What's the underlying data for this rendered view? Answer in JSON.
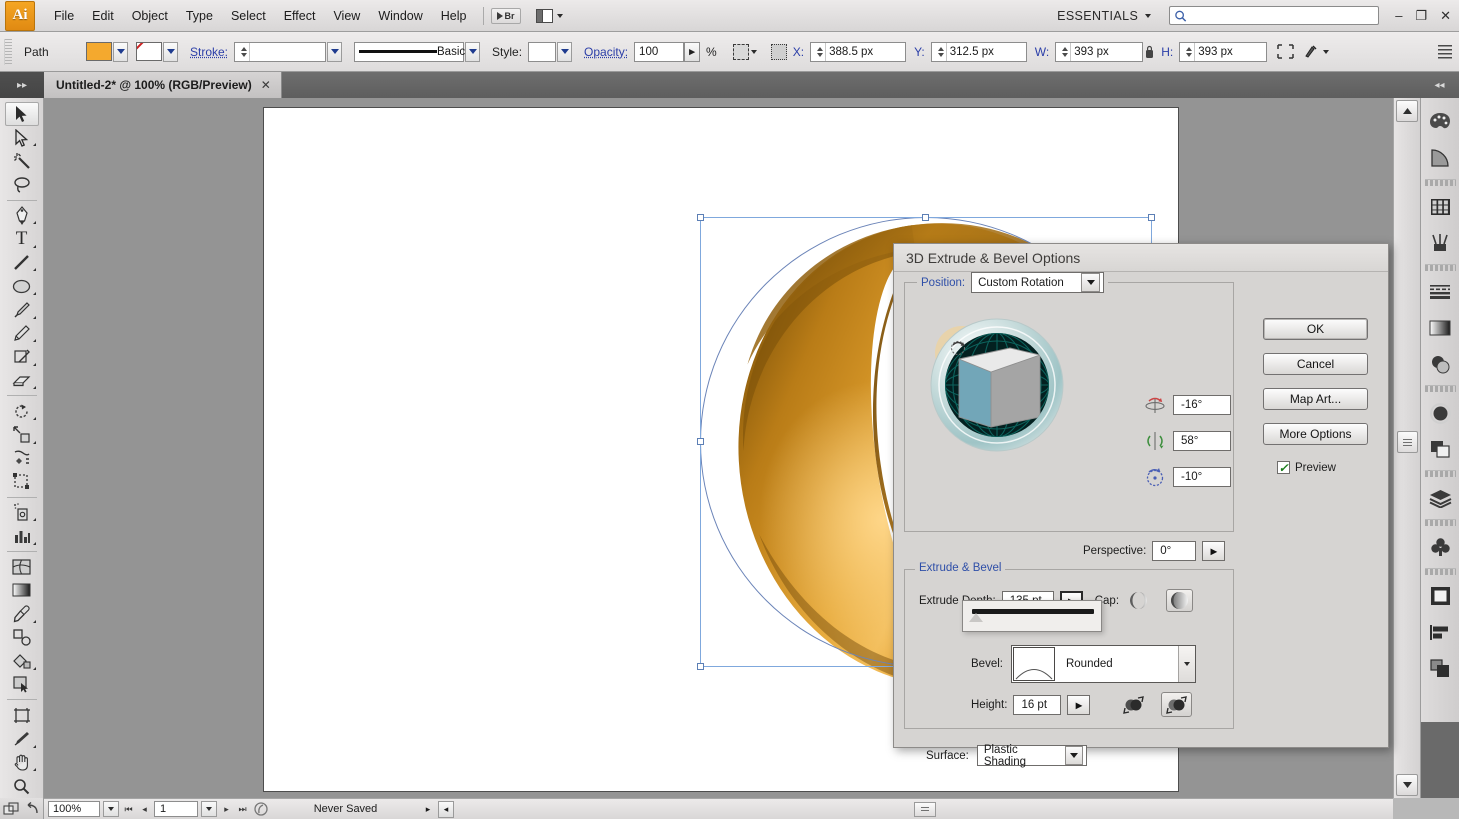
{
  "app": {
    "name": "Ai",
    "menus": [
      "File",
      "Edit",
      "Object",
      "Type",
      "Select",
      "Effect",
      "View",
      "Window",
      "Help"
    ],
    "bridge_label": "Br",
    "workspace": "ESSENTIALS",
    "search_placeholder": "",
    "search_value": "",
    "window_controls": {
      "minimize": "–",
      "maximize": "❐",
      "close": "✕"
    }
  },
  "control_bar": {
    "object_label": "Path",
    "fill_color": "#f4a92e",
    "stroke_color": "none",
    "stroke_label": "Stroke:",
    "stroke_weight": "",
    "brush_label": "Basic",
    "style_label": "Style:",
    "style_value": "",
    "opacity_label": "Opacity:",
    "opacity_value": "100",
    "percent_sign": "%",
    "x_label": "X:",
    "x_value": "388.5 px",
    "y_label": "Y:",
    "y_value": "312.5 px",
    "w_label": "W:",
    "w_value": "393 px",
    "h_label": "H:",
    "h_value": "393 px"
  },
  "document": {
    "tab_title": "Untitled-2* @ 100% (RGB/Preview)",
    "close_glyph": "✕"
  },
  "toolbox": {
    "tools": [
      {
        "name": "selection-tool",
        "glyph": "selection",
        "active": true,
        "corner": false
      },
      {
        "name": "direct-selection-tool",
        "glyph": "direct-selection",
        "active": false,
        "corner": true
      },
      {
        "name": "magic-wand-tool",
        "glyph": "magic-wand",
        "active": false,
        "corner": false
      },
      {
        "name": "lasso-tool",
        "glyph": "lasso",
        "active": false,
        "corner": false
      },
      {
        "name": "pen-tool",
        "glyph": "pen",
        "active": false,
        "corner": true
      },
      {
        "name": "type-tool",
        "glyph": "type",
        "active": false,
        "corner": true
      },
      {
        "name": "line-segment-tool",
        "glyph": "line",
        "active": false,
        "corner": true
      },
      {
        "name": "ellipse-tool",
        "glyph": "ellipse",
        "active": false,
        "corner": true
      },
      {
        "name": "paintbrush-tool",
        "glyph": "paintbrush",
        "active": false,
        "corner": true
      },
      {
        "name": "pencil-tool",
        "glyph": "pencil",
        "active": false,
        "corner": true
      },
      {
        "name": "blob-brush-tool",
        "glyph": "blob-brush",
        "active": false,
        "corner": true
      },
      {
        "name": "eraser-tool",
        "glyph": "eraser",
        "active": false,
        "corner": true
      },
      {
        "name": "rotate-tool",
        "glyph": "rotate",
        "active": false,
        "corner": true
      },
      {
        "name": "scale-tool",
        "glyph": "scale",
        "active": false,
        "corner": true
      },
      {
        "name": "warp-tool",
        "glyph": "warp",
        "active": false,
        "corner": true
      },
      {
        "name": "free-transform-tool",
        "glyph": "free-transform",
        "active": false,
        "corner": false
      },
      {
        "name": "symbol-sprayer-tool",
        "glyph": "symbol-sprayer",
        "active": false,
        "corner": true
      },
      {
        "name": "column-graph-tool",
        "glyph": "graph",
        "active": false,
        "corner": true
      },
      {
        "name": "mesh-tool",
        "glyph": "mesh",
        "active": false,
        "corner": false
      },
      {
        "name": "gradient-tool",
        "glyph": "gradient",
        "active": false,
        "corner": false
      },
      {
        "name": "eyedropper-tool",
        "glyph": "eyedropper",
        "active": false,
        "corner": true
      },
      {
        "name": "blend-tool",
        "glyph": "blend",
        "active": false,
        "corner": false
      },
      {
        "name": "live-paint-bucket-tool",
        "glyph": "live-paint",
        "active": false,
        "corner": true
      },
      {
        "name": "live-paint-selection-tool",
        "glyph": "live-paint-select",
        "active": false,
        "corner": false
      },
      {
        "name": "artboard-tool",
        "glyph": "artboard",
        "active": false,
        "corner": false
      },
      {
        "name": "slice-tool",
        "glyph": "slice",
        "active": false,
        "corner": true
      },
      {
        "name": "hand-tool",
        "glyph": "hand",
        "active": false,
        "corner": true
      },
      {
        "name": "zoom-tool",
        "glyph": "zoom",
        "active": false,
        "corner": false
      }
    ]
  },
  "right_dock": {
    "panels": [
      {
        "name": "color-panel",
        "glyph": "palette"
      },
      {
        "name": "color-guide-panel",
        "glyph": "color-guide"
      },
      {
        "name": "swatches-panel",
        "glyph": "swatches"
      },
      {
        "name": "brushes-panel",
        "glyph": "brushes"
      },
      {
        "name": "stroke-panel",
        "glyph": "stroke-lines"
      },
      {
        "name": "gradient-panel",
        "glyph": "gradient-box"
      },
      {
        "name": "transparency-panel",
        "glyph": "transparency"
      },
      {
        "name": "appearance-panel",
        "glyph": "appearance"
      },
      {
        "name": "graphic-styles-panel",
        "glyph": "graphic-styles"
      },
      {
        "name": "layers-panel",
        "glyph": "layers"
      },
      {
        "name": "symbols-panel",
        "glyph": "symbols"
      },
      {
        "name": "artboards-panel",
        "glyph": "artboards"
      },
      {
        "name": "align-panel",
        "glyph": "align"
      },
      {
        "name": "pathfinder-panel",
        "glyph": "pathfinder"
      }
    ]
  },
  "status_bar": {
    "zoom_level": "100%",
    "page_number": "1",
    "status_text": "Never Saved"
  },
  "dialog": {
    "title": "3D Extrude & Bevel Options",
    "position_label": "Position:",
    "position_value": "Custom Rotation",
    "rotation_x": "-16°",
    "rotation_y": "58°",
    "rotation_z": "-10°",
    "perspective_label": "Perspective:",
    "perspective_value": "0°",
    "buttons": {
      "ok": "OK",
      "cancel": "Cancel",
      "map_art": "Map Art...",
      "more_options": "More Options",
      "preview": "Preview",
      "preview_checked": true
    },
    "extrude_group_title": "Extrude & Bevel",
    "extrude_depth_label": "Extrude Depth:",
    "extrude_depth_value": "135 pt",
    "cap_label": "Cap:",
    "bevel_label": "Bevel:",
    "bevel_value": "Rounded",
    "height_label": "Height:",
    "height_value": "16 pt",
    "surface_label": "Surface:",
    "surface_value": "Plastic Shading"
  },
  "artwork": {
    "name": "3d-gold-ring",
    "fill_highlight": "#f0a83c",
    "fill_mid": "#d9912a",
    "fill_shadow": "#a06a13"
  }
}
